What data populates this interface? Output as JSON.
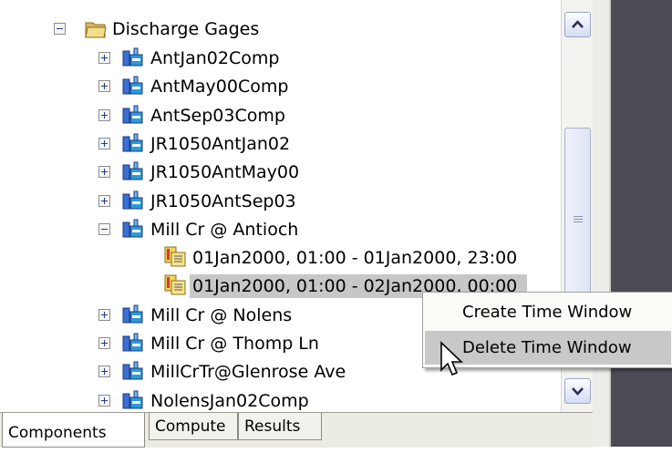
{
  "tree": {
    "root": {
      "label": "Discharge Gages",
      "icon": "folder-open-icon"
    },
    "items": [
      {
        "label": "AntJan02Comp",
        "icon": "gage-icon",
        "expander": "plus"
      },
      {
        "label": "AntMay00Comp",
        "icon": "gage-icon",
        "expander": "plus"
      },
      {
        "label": "AntSep03Comp",
        "icon": "gage-icon",
        "expander": "plus"
      },
      {
        "label": "JR1050AntJan02",
        "icon": "gage-icon",
        "expander": "plus"
      },
      {
        "label": "JR1050AntMay00",
        "icon": "gage-icon",
        "expander": "plus"
      },
      {
        "label": "JR1050AntSep03",
        "icon": "gage-icon",
        "expander": "plus"
      },
      {
        "label": "Mill Cr @ Antioch",
        "icon": "gage-icon",
        "expander": "minus"
      },
      {
        "label": "01Jan2000, 01:00 - 01Jan2000, 23:00",
        "icon": "time-window-icon",
        "child": true
      },
      {
        "label": "01Jan2000, 01:00 - 02Jan2000, 00:00",
        "icon": "time-window-icon",
        "child": true,
        "selected": true
      },
      {
        "label": "Mill Cr @ Nolens",
        "icon": "gage-icon",
        "expander": "plus"
      },
      {
        "label": "Mill Cr @ Thomp Ln",
        "icon": "gage-icon",
        "expander": "plus"
      },
      {
        "label": "MillCrTr@Glenrose Ave",
        "icon": "gage-icon",
        "expander": "plus"
      },
      {
        "label": "NolensJan02Comp",
        "icon": "gage-icon",
        "expander": "plus"
      }
    ]
  },
  "context_menu": {
    "items": [
      {
        "label": "Create Time Window"
      },
      {
        "label": "Delete Time Window",
        "highlighted": true
      }
    ]
  },
  "tabs": [
    {
      "label": "Components",
      "active": true
    },
    {
      "label": "Compute",
      "active": false
    },
    {
      "label": "Results",
      "active": false
    }
  ],
  "colors": {
    "selection": "#c7c7c7",
    "panel_dark": "#4b4a55",
    "menu_highlight": "#c8c8c8"
  }
}
